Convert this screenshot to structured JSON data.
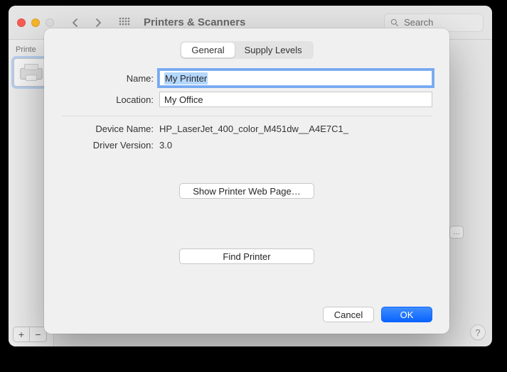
{
  "window": {
    "title": "Printers & Scanners",
    "search_placeholder": "Search"
  },
  "sidebar": {
    "header": "Printe",
    "add_label": "+",
    "remove_label": "−"
  },
  "sheet": {
    "tabs": {
      "general": "General",
      "supply": "Supply Levels"
    },
    "labels": {
      "name": "Name:",
      "location": "Location:",
      "device_name": "Device Name:",
      "driver_version": "Driver Version:"
    },
    "values": {
      "name": "My Printer",
      "location": "My Office",
      "device_name": "HP_LaserJet_400_color_M451dw__A4E7C1_",
      "driver_version": "3.0"
    },
    "buttons": {
      "web_page": "Show Printer Web Page…",
      "find": "Find Printer",
      "cancel": "Cancel",
      "ok": "OK"
    }
  },
  "help_label": "?"
}
